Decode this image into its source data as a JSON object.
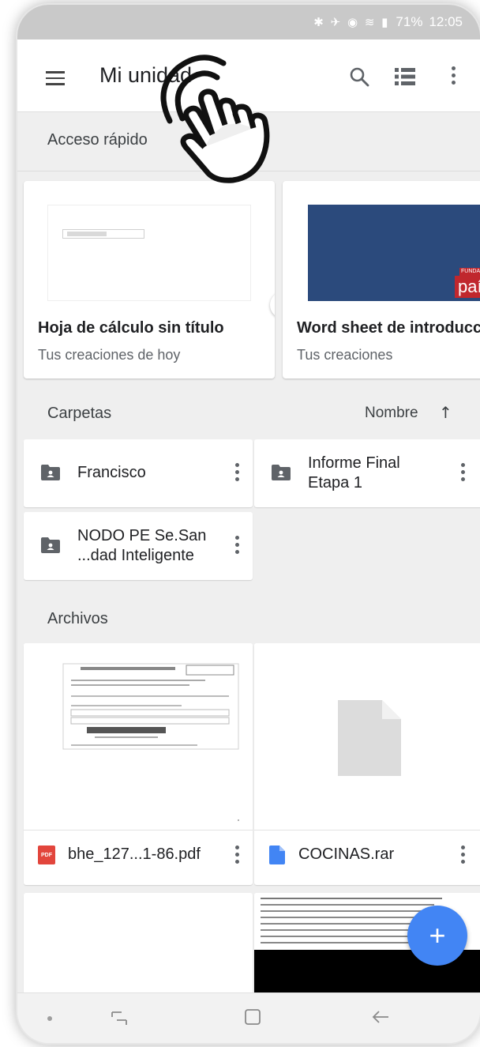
{
  "status_bar": {
    "icons": "✱ ✈ ◉ ≋ ▮",
    "battery": "71%",
    "time": "12:05"
  },
  "app_bar": {
    "title": "Mi unidad",
    "icons": [
      "menu-icon",
      "search-icon",
      "list-view-icon",
      "more-vert-icon"
    ]
  },
  "quick_access": {
    "label": "Acceso rápido",
    "cards": [
      {
        "title": "Hoja de cálculo sin título",
        "subtitle": "Tus creaciones de hoy",
        "type": "sheets"
      },
      {
        "title": "Word sheet de introducción",
        "subtitle": "Tus creaciones",
        "type": "slides",
        "brand": "país",
        "brand_top": "FUNDACIÓN"
      }
    ]
  },
  "folders": {
    "label": "Carpetas",
    "sort_label": "Nombre",
    "sort_direction": "↑",
    "items": [
      {
        "line1": "Francisco",
        "line2": ""
      },
      {
        "line1": "Informe Final",
        "line2": "Etapa 1"
      },
      {
        "line1": "NODO PE Se.San",
        "line2": "...dad Inteligente"
      }
    ]
  },
  "files": {
    "label": "Archivos",
    "items": [
      {
        "name": "bhe_127...1-86.pdf",
        "type": "pdf",
        "badge": "PDF"
      },
      {
        "name": "COCINAS.rar",
        "type": "doc"
      }
    ]
  },
  "fab": {
    "label": "+"
  },
  "colors": {
    "accent": "#4285f4",
    "sheets_green": "#0f9d58",
    "pdf_red": "#e2453c",
    "status_bar": "#c9c9c9"
  }
}
